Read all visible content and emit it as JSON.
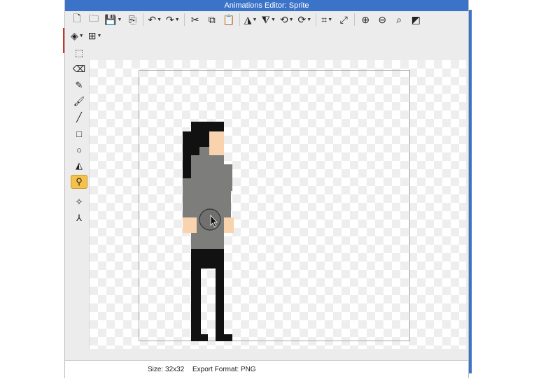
{
  "window": {
    "title": "Animations Editor: Sprite"
  },
  "toolbar_row1": [
    {
      "name": "new-file-icon",
      "glyph": "🗋",
      "arrow": false
    },
    {
      "name": "open-folder-icon",
      "glyph": "🗀",
      "arrow": false
    },
    {
      "name": "save-icon",
      "glyph": "💾",
      "arrow": true
    },
    {
      "name": "export-icon",
      "glyph": "⎘",
      "arrow": false
    },
    {
      "name": "undo-icon",
      "glyph": "↶",
      "arrow": true
    },
    {
      "name": "redo-icon",
      "glyph": "↷",
      "arrow": true
    },
    {
      "name": "cut-icon",
      "glyph": "✂",
      "arrow": false
    },
    {
      "name": "copy-icon",
      "glyph": "⧉",
      "arrow": false
    },
    {
      "name": "paste-icon",
      "glyph": "📋",
      "arrow": false
    },
    {
      "name": "flip-horizontal-icon",
      "glyph": "◮",
      "arrow": true
    },
    {
      "name": "flip-vertical-icon",
      "glyph": "⧨",
      "arrow": true
    },
    {
      "name": "rotate-left-icon",
      "glyph": "⟲",
      "arrow": true
    },
    {
      "name": "rotate-right-icon",
      "glyph": "⟳",
      "arrow": true
    },
    {
      "name": "crop-icon",
      "glyph": "⌗",
      "arrow": true
    },
    {
      "name": "resize-icon",
      "glyph": "⤢",
      "arrow": false
    },
    {
      "name": "zoom-in-icon",
      "glyph": "⊕",
      "arrow": false
    },
    {
      "name": "zoom-out-icon",
      "glyph": "⊖",
      "arrow": false
    },
    {
      "name": "zoom-fit-icon",
      "glyph": "⌕",
      "arrow": false
    },
    {
      "name": "background-color-icon",
      "glyph": "◩",
      "arrow": false
    }
  ],
  "toolbar_row2": [
    {
      "name": "layers-icon",
      "glyph": "◈",
      "arrow": true
    },
    {
      "name": "grid-icon",
      "glyph": "⊞",
      "arrow": true
    }
  ],
  "left_tools": [
    {
      "name": "select-rectangle-icon",
      "glyph": "⬚",
      "active": false
    },
    {
      "name": "eraser-icon",
      "glyph": "⌫",
      "active": false
    },
    {
      "name": "pencil-icon",
      "glyph": "✎",
      "active": false
    },
    {
      "name": "brush-icon",
      "glyph": "🖌",
      "active": false
    },
    {
      "name": "line-icon",
      "glyph": "╱",
      "active": false
    },
    {
      "name": "rectangle-icon",
      "glyph": "□",
      "active": false
    },
    {
      "name": "ellipse-icon",
      "glyph": "○",
      "active": false
    },
    {
      "name": "paint-bucket-icon",
      "glyph": "◭",
      "active": false
    },
    {
      "name": "eyedropper-icon",
      "glyph": "⚲",
      "active": true
    },
    {
      "name": "origin-point-icon",
      "glyph": "✧",
      "active": false
    },
    {
      "name": "attach-point-icon",
      "glyph": "⅄",
      "active": false
    }
  ],
  "status": {
    "size_label": "Size: 32x32",
    "format_label": "Export Format: PNG"
  },
  "colors": {
    "hair": "#111111",
    "skin": "#f9d3ae",
    "shirt": "#7d7d7b",
    "pants": "#111111",
    "titlebar": "#3b73c9"
  }
}
